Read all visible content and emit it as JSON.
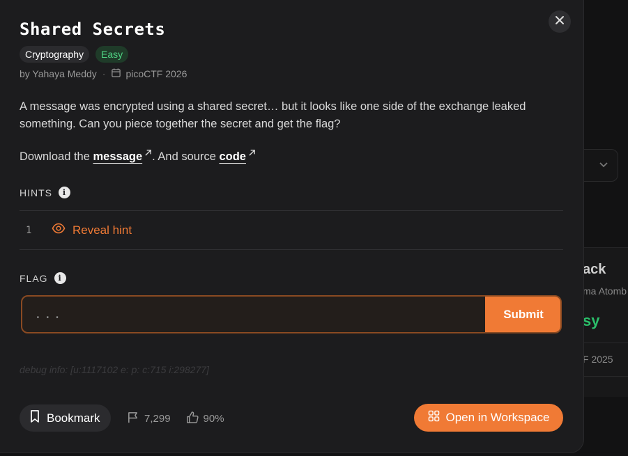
{
  "background": {
    "card_title": "ack",
    "card_author": "ma Atomb",
    "card_difficulty": "sy",
    "card_event": "F 2025"
  },
  "challenge": {
    "title": "Shared Secrets",
    "category": "Cryptography",
    "difficulty": "Easy",
    "author": "by Yahaya Meddy",
    "separator": "·",
    "event": "picoCTF 2026",
    "description": "A message was encrypted using a shared secret… but it looks like one side of the exchange leaked something. Can you piece together the secret and get the flag?",
    "download_prefix": "Download the ",
    "message_link": "message",
    "download_middle": ". And source ",
    "code_link": "code"
  },
  "hints": {
    "label": "HINTS",
    "items": [
      {
        "number": "1",
        "label": "Reveal hint"
      }
    ]
  },
  "flag": {
    "label": "FLAG",
    "placeholder": "...",
    "submit_label": "Submit"
  },
  "debug_info": "debug info: [u:1117102 e: p: c:715 i:298277]",
  "footer": {
    "bookmark_label": "Bookmark",
    "solves": "7,299",
    "rating": "90%",
    "workspace_label": "Open in Workspace"
  },
  "colors": {
    "accent": "#f07a35",
    "easy": "#4fd283",
    "modal_bg": "#1c1c1e"
  },
  "icons": [
    "close-icon",
    "calendar-icon",
    "external-link-icon",
    "info-icon",
    "eye-icon",
    "bookmark-icon",
    "flag-icon",
    "thumbs-up-icon",
    "grid-icon",
    "chevron-down-icon"
  ]
}
